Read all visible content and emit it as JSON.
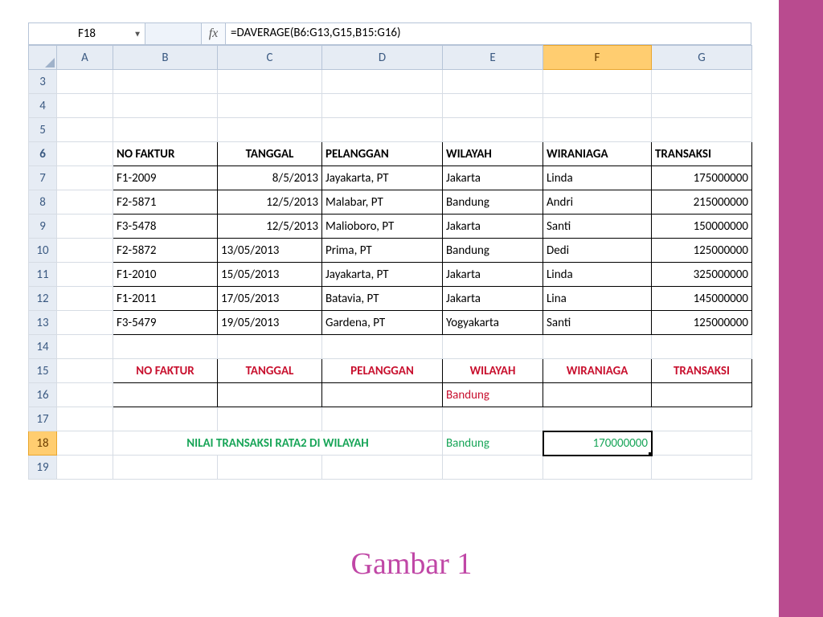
{
  "formula_bar": {
    "cell_ref": "F18",
    "fx_label": "fx",
    "formula": "=DAVERAGE(B6:G13,G15,B15:G16)"
  },
  "columns": [
    "A",
    "B",
    "C",
    "D",
    "E",
    "F",
    "G"
  ],
  "row_nums": [
    "3",
    "4",
    "5",
    "6",
    "7",
    "8",
    "9",
    "10",
    "11",
    "12",
    "13",
    "14",
    "15",
    "16",
    "17",
    "18",
    "19"
  ],
  "tbl_headers": [
    "NO FAKTUR",
    "TANGGAL",
    "PELANGGAN",
    "WILAYAH",
    "WIRANIAGA",
    "TRANSAKSI"
  ],
  "rows": [
    {
      "nf": "F1-2009",
      "tg": "8/5/2013",
      "pl": "Jayakarta, PT",
      "wl": "Jakarta",
      "wr": "Linda",
      "tr": "175000000"
    },
    {
      "nf": "F2-5871",
      "tg": "12/5/2013",
      "pl": "Malabar, PT",
      "wl": "Bandung",
      "wr": "Andri",
      "tr": "215000000"
    },
    {
      "nf": "F3-5478",
      "tg": "12/5/2013",
      "pl": "Malioboro, PT",
      "wl": "Jakarta",
      "wr": "Santi",
      "tr": "150000000"
    },
    {
      "nf": "F2-5872",
      "tg": "13/05/2013",
      "pl": "Prima, PT",
      "wl": "Bandung",
      "wr": "Dedi",
      "tr": "125000000"
    },
    {
      "nf": "F1-2010",
      "tg": "15/05/2013",
      "pl": "Jayakarta, PT",
      "wl": "Jakarta",
      "wr": "Linda",
      "tr": "325000000"
    },
    {
      "nf": "F1-2011",
      "tg": "17/05/2013",
      "pl": "Batavia, PT",
      "wl": "Jakarta",
      "wr": "Lina",
      "tr": "145000000"
    },
    {
      "nf": "F3-5479",
      "tg": "19/05/2013",
      "pl": "Gardena, PT",
      "wl": "Yogyakarta",
      "wr": "Santi",
      "tr": "125000000"
    }
  ],
  "criteria_headers": [
    "NO FAKTUR",
    "TANGGAL",
    "PELANGGAN",
    "WILAYAH",
    "WIRANIAGA",
    "TRANSAKSI"
  ],
  "criteria_value": "Bandung",
  "result_row": {
    "label": "NILAI TRANSAKSI RATA2 DI WILAYAH",
    "wilayah": "Bandung",
    "value": "170000000"
  },
  "caption": "Gambar 1"
}
